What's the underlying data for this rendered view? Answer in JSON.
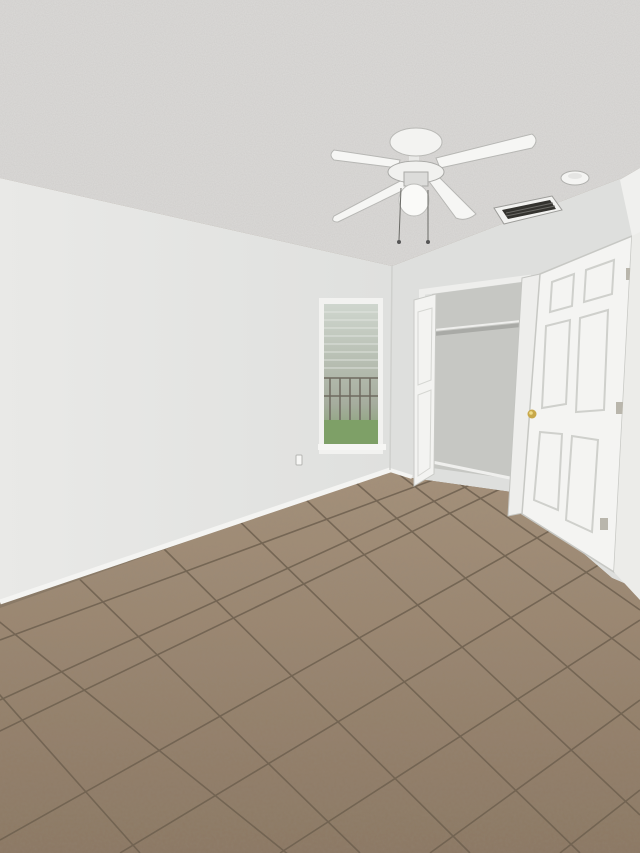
{
  "photo": {
    "subject": "empty-bedroom",
    "colors": {
      "ceiling": "#dcdad8",
      "wall_left": "#e6e6e4",
      "wall_right": "#dedfdd",
      "closet_interior": "#c9cac6",
      "door": "#f2f2f0",
      "floor_tile": "#9a8670",
      "grout": "#6f604f",
      "baseboard": "#f4f4f2",
      "window_glass": "#b9c3b4",
      "fan": "#f3f3f1"
    },
    "icons": {
      "fan": "ceiling-fan-icon",
      "vent": "air-vent-icon",
      "smoke_detector": "smoke-detector-icon",
      "outlet": "wall-outlet-icon",
      "door_knob": "door-knob-icon"
    }
  }
}
